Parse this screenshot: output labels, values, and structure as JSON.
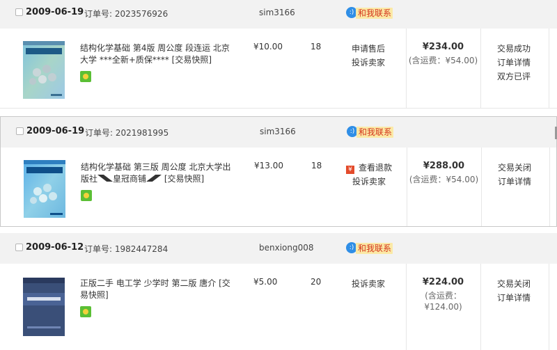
{
  "orders": [
    {
      "date": "2009-06-19",
      "order_label": "订单号: 2023576926",
      "seller": "sim3166",
      "contact_label": "和我联系",
      "title": "结构化学基础 第4版 周公度 段连运 北京大学 ***全新+质保**** [交易快照]",
      "price": "¥10.00",
      "qty": "18",
      "actions": [
        "申请售后",
        "投诉卖家"
      ],
      "total": "¥234.00",
      "shipping": "(含运费：¥54.00)",
      "status": [
        "交易成功",
        "订单详情",
        "双方已评"
      ]
    },
    {
      "date": "2009-06-19",
      "order_label": "订单号: 2021981995",
      "seller": "sim3166",
      "contact_label": "和我联系",
      "title_pre": "结构化学基础 第三版 周公度 北京大学出版社",
      "title_shop": "皇冠商铺",
      "title_post": " [交易快照]",
      "price": "¥13.00",
      "qty": "18",
      "refund_label": "查看退款",
      "actions": [
        "投诉卖家"
      ],
      "total": "¥288.00",
      "shipping": "(含运费：¥54.00)",
      "status": [
        "交易关闭",
        "订单详情"
      ]
    },
    {
      "date": "2009-06-12",
      "order_label": "订单号: 1982447284",
      "seller": "benxiong008",
      "contact_label": "和我联系",
      "title": "正版二手 电工学 少学时 第二版 唐介 [交易快照]",
      "price": "¥5.00",
      "qty": "20",
      "actions": [
        "投诉卖家"
      ],
      "total": "¥224.00",
      "shipping_line1": "(含运费：",
      "shipping_line2": "¥124.00)",
      "status": [
        "交易关闭",
        "订单详情"
      ]
    }
  ],
  "colors": {
    "header_bg": "#f2f2f2",
    "contact_bg": "#fbe9a6",
    "contact_text": "#d4351c",
    "ww_icon": "#2f8ee6",
    "flag": "#5bbf35",
    "refund_icon": "#e34b2b"
  },
  "icons": {
    "contact": "wangwang-icon",
    "refund": "refund-icon",
    "consumer_protection": "consumer-protection-icon"
  }
}
